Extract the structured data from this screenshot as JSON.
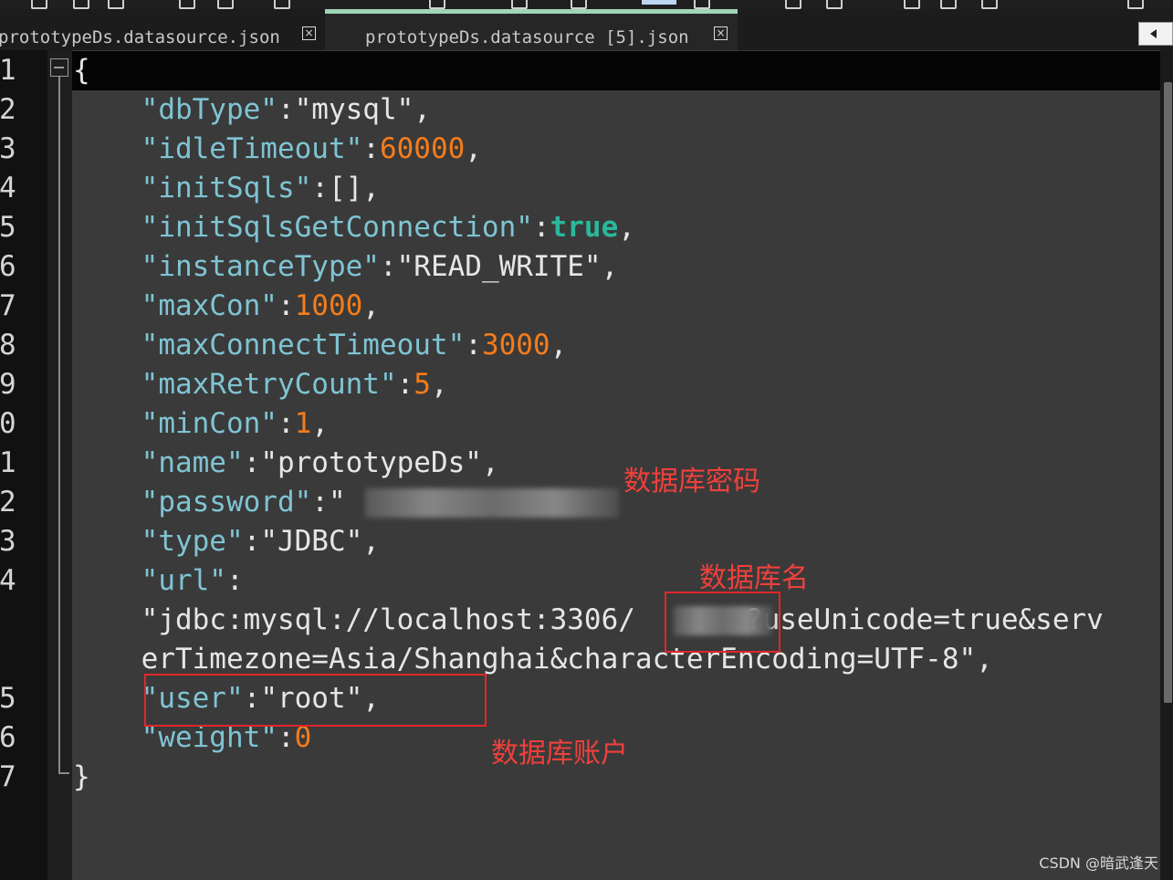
{
  "tabs": [
    {
      "label": "prototypeDs.datasource.json"
    },
    {
      "label": "prototypeDs.datasource [5].json"
    }
  ],
  "close_glyph": "×",
  "line_numbers": [
    "1",
    "2",
    "3",
    "4",
    "5",
    "6",
    "7",
    "8",
    "9",
    "0",
    "1",
    "2",
    "3",
    "4",
    "5",
    "6",
    "7"
  ],
  "code": {
    "open": "{",
    "db_type_key": "\"dbType\"",
    "db_type_val": "\"mysql\"",
    "idle_key": "\"idleTimeout\"",
    "idle_val": "60000",
    "init_key": "\"initSqls\"",
    "init_val": "[]",
    "init_conn_key": "\"initSqlsGetConnection\"",
    "init_conn_val": "true",
    "inst_key": "\"instanceType\"",
    "inst_val": "\"READ_WRITE\"",
    "maxcon_key": "\"maxCon\"",
    "maxcon_val": "1000",
    "maxct_key": "\"maxConnectTimeout\"",
    "maxct_val": "3000",
    "maxretry_key": "\"maxRetryCount\"",
    "maxretry_val": "5",
    "mincon_key": "\"minCon\"",
    "mincon_val": "1",
    "name_key": "\"name\"",
    "name_val": "\"prototypeDs\"",
    "password_key": "\"password\"",
    "password_val": "\"",
    "type_key": "\"type\"",
    "type_val": "\"JDBC\"",
    "url_key": "\"url\"",
    "url_line1_a": "\"jdbc:mysql://localhost:3306/",
    "url_line1_b": "?useUnicode=true&serv",
    "url_line2": "erTimezone=Asia/Shanghai&characterEncoding=UTF-8\"",
    "user_key": "\"user\"",
    "user_val": "\"root\"",
    "weight_key": "\"weight\"",
    "weight_val": "0",
    "close": "}"
  },
  "annotations": {
    "password_note": "数据库密码",
    "dbname_note": "数据库名",
    "user_note": "数据库账户"
  },
  "watermark": "CSDN @暗武逢天",
  "colors": {
    "key": "#7fc4d3",
    "number": "#f57c1a",
    "boolean": "#2ab89a",
    "annotation": "#f0403c"
  }
}
